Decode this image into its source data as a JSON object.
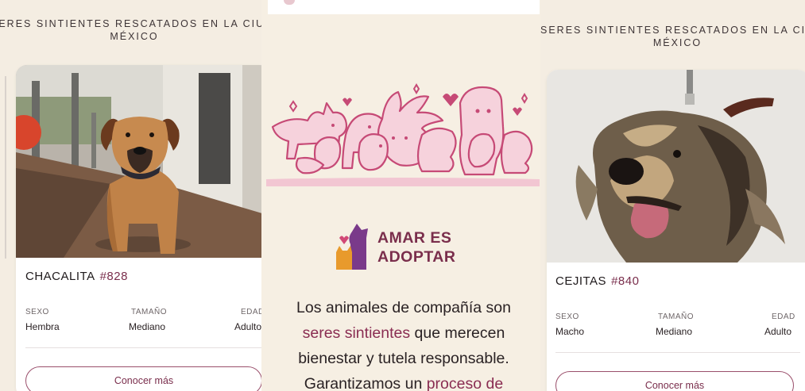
{
  "colors": {
    "accent": "#7a2e4c",
    "background": "#f4ede2",
    "illustration_pink": "#d66289"
  },
  "left_panel": {
    "heading_line1": "SERES SINTIENTES RESCATADOS EN LA CIUDAD DE",
    "heading_line2": "MÉXICO",
    "card": {
      "photo_icon": "dog-photo",
      "name": "CHACALITA",
      "number": "#828",
      "attrs": [
        {
          "label": "SEXO",
          "value": "Hembra"
        },
        {
          "label": "TAMAÑO",
          "value": "Mediano"
        },
        {
          "label": "EDAD",
          "value": "Adulto"
        }
      ],
      "button": "Conocer más"
    }
  },
  "middle_panel": {
    "illustration_icon": "animals-group-illustration",
    "brand_icon": "dog-cat-heart-logo-icon",
    "brand_line1": "AMAR ES",
    "brand_line2": "ADOPTAR",
    "para_line1": "Los animales de compañía son",
    "para_hl1": "seres sintientes",
    "para_line2_rest": " que merecen",
    "para_line3": "bienestar y tutela responsable.",
    "para_line4_start": "Garantizamos un ",
    "para_hl2": "proceso de"
  },
  "right_panel": {
    "heading_line1": "SERES SINTIENTES RESCATADOS EN LA CIUDAD DE",
    "heading_line2": "MÉXICO",
    "card": {
      "photo_icon": "dog-photo",
      "name": "CEJITAS",
      "number": "#840",
      "attrs": [
        {
          "label": "SEXO",
          "value": "Macho"
        },
        {
          "label": "TAMAÑO",
          "value": "Mediano"
        },
        {
          "label": "EDAD",
          "value": "Adulto"
        }
      ],
      "button": "Conocer más"
    }
  }
}
